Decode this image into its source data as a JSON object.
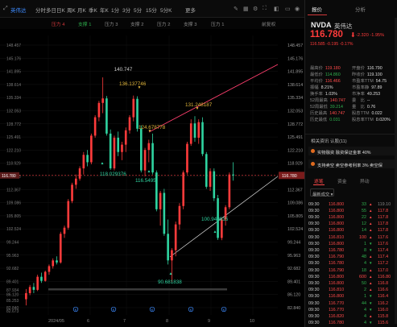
{
  "toolbar": {
    "tabs": [
      {
        "label": "分时",
        "active": false
      },
      {
        "label": "多日",
        "active": false
      },
      {
        "label": "日K",
        "active": false
      },
      {
        "label": "周K",
        "active": false
      },
      {
        "label": "月K",
        "active": false
      },
      {
        "label": "季K",
        "active": false
      },
      {
        "label": "年K",
        "active": false
      },
      {
        "label": "1分",
        "active": false
      },
      {
        "label": "3分",
        "active": false
      },
      {
        "label": "5分",
        "active": false
      },
      {
        "label": "15分",
        "active": false
      },
      {
        "label": "5分K",
        "active": false
      }
    ],
    "main_label": "英伟达",
    "more_label": "更多"
  },
  "indicators": [
    {
      "label": "压力 4",
      "color": "red"
    },
    {
      "label": "支撑 1",
      "color": "green"
    },
    {
      "label": "压力 3",
      "color": "gray"
    },
    {
      "label": "支撑 2",
      "color": "gray"
    },
    {
      "label": "压力 2",
      "color": "gray"
    },
    {
      "label": "支撑 3",
      "color": "gray"
    },
    {
      "label": "压力 1",
      "color": "gray"
    },
    {
      "label": "前复权",
      "color": "gray"
    }
  ],
  "chart_data": {
    "type": "candlestick",
    "ylim": [
      82.673,
      151.0
    ],
    "y_ticks": [
      "148.457",
      "145.176",
      "141.895",
      "138.614",
      "135.334",
      "132.053",
      "128.772",
      "125.491",
      "122.210",
      "118.929",
      "115.648",
      "112.367",
      "109.086",
      "105.805",
      "102.524",
      "99.244",
      "95.963",
      "92.682",
      "89.401",
      "86.120",
      "82.840"
    ],
    "y_ticks_bottom_labels": [
      "87.934",
      "85.253",
      "82.673"
    ],
    "current_price_label": "116.780",
    "current_price": 116.78,
    "x_ticks": [
      "2024/05",
      "6",
      "7",
      "8",
      "9",
      "10"
    ],
    "annotations": [
      {
        "text": "140.747",
        "value": 140.747,
        "kind": "high",
        "color": "#cccccc"
      },
      {
        "text": "136.137746",
        "value": 136.138,
        "kind": "pivot",
        "color": "#e0b53a"
      },
      {
        "text": "124.678778",
        "value": 124.679,
        "kind": "pivot",
        "color": "#e0b53a"
      },
      {
        "text": "131.248187",
        "value": 131.248,
        "kind": "pivot",
        "color": "#e0b53a"
      },
      {
        "text": "118.029376",
        "value": 118.029,
        "kind": "support",
        "color": "#2fd3a0"
      },
      {
        "text": "116.5495",
        "value": 116.55,
        "kind": "support",
        "color": "#2fd3a0"
      },
      {
        "text": "100.940915",
        "value": 100.941,
        "kind": "support",
        "color": "#2fd3a0"
      },
      {
        "text": "90.681838",
        "value": 90.682,
        "kind": "support",
        "color": "#2fd3a0"
      }
    ],
    "candles": [
      {
        "o": 86.5,
        "h": 89.0,
        "l": 85.0,
        "c": 88.0
      },
      {
        "o": 88.0,
        "h": 90.0,
        "l": 87.5,
        "c": 89.5
      },
      {
        "o": 89.5,
        "h": 90.5,
        "l": 88.0,
        "c": 88.8
      },
      {
        "o": 88.8,
        "h": 92.5,
        "l": 88.5,
        "c": 92.0
      },
      {
        "o": 92.0,
        "h": 93.0,
        "l": 90.5,
        "c": 91.0
      },
      {
        "o": 91.0,
        "h": 93.5,
        "l": 90.8,
        "c": 93.2
      },
      {
        "o": 93.2,
        "h": 95.0,
        "l": 92.5,
        "c": 94.6
      },
      {
        "o": 94.6,
        "h": 96.5,
        "l": 94.0,
        "c": 96.0
      },
      {
        "o": 96.0,
        "h": 97.0,
        "l": 95.0,
        "c": 95.5
      },
      {
        "o": 95.5,
        "h": 103.0,
        "l": 95.2,
        "c": 102.5
      },
      {
        "o": 102.5,
        "h": 104.5,
        "l": 101.5,
        "c": 104.0
      },
      {
        "o": 104.0,
        "h": 111.0,
        "l": 103.5,
        "c": 110.5
      },
      {
        "o": 110.5,
        "h": 115.0,
        "l": 110.0,
        "c": 114.5
      },
      {
        "o": 114.5,
        "h": 117.0,
        "l": 113.5,
        "c": 116.0
      },
      {
        "o": 116.0,
        "h": 119.0,
        "l": 115.5,
        "c": 118.5
      },
      {
        "o": 118.5,
        "h": 122.5,
        "l": 117.0,
        "c": 121.8
      },
      {
        "o": 121.8,
        "h": 123.0,
        "l": 119.0,
        "c": 120.0
      },
      {
        "o": 120.0,
        "h": 127.0,
        "l": 119.5,
        "c": 126.5
      },
      {
        "o": 126.5,
        "h": 131.5,
        "l": 126.0,
        "c": 131.0
      },
      {
        "o": 131.0,
        "h": 135.0,
        "l": 130.0,
        "c": 134.5
      },
      {
        "o": 134.5,
        "h": 140.747,
        "l": 132.0,
        "c": 135.6
      },
      {
        "o": 135.6,
        "h": 136.2,
        "l": 126.5,
        "c": 127.0
      },
      {
        "o": 127.0,
        "h": 128.0,
        "l": 118.1,
        "c": 118.5
      },
      {
        "o": 118.5,
        "h": 126.5,
        "l": 118.03,
        "c": 126.0
      },
      {
        "o": 126.0,
        "h": 127.5,
        "l": 121.5,
        "c": 122.5
      },
      {
        "o": 122.5,
        "h": 125.0,
        "l": 120.5,
        "c": 124.3
      },
      {
        "o": 124.3,
        "h": 128.5,
        "l": 122.5,
        "c": 127.8
      },
      {
        "o": 127.8,
        "h": 131.5,
        "l": 127.0,
        "c": 131.0
      },
      {
        "o": 131.0,
        "h": 136.3,
        "l": 130.0,
        "c": 135.5
      },
      {
        "o": 135.5,
        "h": 136.14,
        "l": 127.5,
        "c": 128.2
      },
      {
        "o": 128.2,
        "h": 129.0,
        "l": 117.5,
        "c": 118.0
      },
      {
        "o": 118.0,
        "h": 123.5,
        "l": 116.55,
        "c": 123.0
      },
      {
        "o": 123.0,
        "h": 125.5,
        "l": 120.0,
        "c": 124.679
      },
      {
        "o": 124.679,
        "h": 127.0,
        "l": 117.0,
        "c": 117.5
      },
      {
        "o": 117.5,
        "h": 118.0,
        "l": 108.0,
        "c": 108.5
      },
      {
        "o": 108.5,
        "h": 113.0,
        "l": 104.5,
        "c": 112.5
      },
      {
        "o": 112.5,
        "h": 113.5,
        "l": 102.0,
        "c": 102.5
      },
      {
        "o": 102.5,
        "h": 106.0,
        "l": 95.0,
        "c": 96.0
      },
      {
        "o": 96.0,
        "h": 99.0,
        "l": 90.682,
        "c": 98.5
      },
      {
        "o": 98.5,
        "h": 105.5,
        "l": 97.0,
        "c": 104.8
      },
      {
        "o": 104.8,
        "h": 110.0,
        "l": 103.5,
        "c": 109.3
      },
      {
        "o": 109.3,
        "h": 118.0,
        "l": 108.5,
        "c": 117.5
      },
      {
        "o": 117.5,
        "h": 125.0,
        "l": 117.0,
        "c": 124.5
      },
      {
        "o": 124.5,
        "h": 130.5,
        "l": 124.0,
        "c": 129.5
      },
      {
        "o": 129.5,
        "h": 131.248,
        "l": 125.0,
        "c": 126.0
      },
      {
        "o": 126.0,
        "h": 130.5,
        "l": 124.5,
        "c": 129.8
      },
      {
        "o": 129.8,
        "h": 131.0,
        "l": 121.5,
        "c": 122.0
      },
      {
        "o": 122.0,
        "h": 122.5,
        "l": 113.5,
        "c": 114.0
      },
      {
        "o": 114.0,
        "h": 118.5,
        "l": 113.0,
        "c": 117.8
      },
      {
        "o": 117.8,
        "h": 118.5,
        "l": 110.5,
        "c": 111.2
      },
      {
        "o": 111.2,
        "h": 112.0,
        "l": 101.0,
        "c": 101.5
      },
      {
        "o": 101.5,
        "h": 106.5,
        "l": 100.941,
        "c": 106.0
      },
      {
        "o": 106.0,
        "h": 109.5,
        "l": 104.5,
        "c": 109.0
      },
      {
        "o": 109.0,
        "h": 117.5,
        "l": 108.5,
        "c": 117.0
      },
      {
        "o": 117.0,
        "h": 120.0,
        "l": 115.5,
        "c": 116.78
      }
    ]
  },
  "right_panel": {
    "tabs": [
      "报价",
      "分析"
    ],
    "ticker": "NVDA",
    "name": "英伟达",
    "price": "116.780",
    "change": "-2.320  -1.95%",
    "after_hours": "116.585  -0.195  -0.17%",
    "quote_rows": [
      [
        {
          "k": "最高价",
          "v": "119.180",
          "c": "red"
        },
        {
          "k": "开盘价",
          "v": "116.790",
          "c": "white"
        }
      ],
      [
        {
          "k": "最低价",
          "v": "114.860",
          "c": "green"
        },
        {
          "k": "昨收价",
          "v": "119.100",
          "c": "white"
        }
      ],
      [
        {
          "k": "平均价",
          "v": "116.466",
          "c": "red"
        },
        {
          "k": "市盈率TTM",
          "v": "54.75",
          "c": "white"
        }
      ],
      [
        {
          "k": "振幅",
          "v": "8.21%",
          "c": "white"
        },
        {
          "k": "市盈率静",
          "v": "97.89",
          "c": "white"
        }
      ],
      [
        {
          "k": "换手率",
          "v": "1.03%",
          "c": "white"
        },
        {
          "k": "市净率",
          "v": "49.253",
          "c": "white"
        }
      ],
      [
        {
          "k": "52周最高",
          "v": "140.747",
          "c": "red"
        },
        {
          "k": "委　比",
          "v": "--",
          "c": "white"
        }
      ],
      [
        {
          "k": "52周最低",
          "v": "39.214",
          "c": "green"
        },
        {
          "k": "量　比",
          "v": "0.76",
          "c": "white"
        }
      ],
      [
        {
          "k": "历史最高",
          "v": "140.747",
          "c": "red"
        },
        {
          "k": "股息TTM",
          "v": "0.022",
          "c": "white"
        }
      ],
      [
        {
          "k": "历史最低",
          "v": "0.031",
          "c": "green"
        },
        {
          "k": "股息率TTM",
          "v": "0.020%",
          "c": "white"
        }
      ]
    ],
    "related_title": "相关资讯  认股(11)",
    "notices": [
      "实物融资  融资保证金率 40%",
      "支持卖空  卖空参考利率 3%  卖空保"
    ],
    "subtabs": [
      "逐笔",
      "资金",
      "异动"
    ],
    "filter_label": "最新成交 ▾",
    "trades": [
      {
        "t": "09:30",
        "p": "116.800",
        "v": "33",
        "d": "▲",
        "dc": "red",
        "s": "119.10",
        "sc": "gray"
      },
      {
        "t": "09:30",
        "p": "116.800",
        "v": "55",
        "d": "▲",
        "dc": "red",
        "s": "117.8",
        "sc": "red"
      },
      {
        "t": "09:30",
        "p": "116.800",
        "v": "22",
        "d": "▲",
        "dc": "red",
        "s": "117.8",
        "sc": "red"
      },
      {
        "t": "09:30",
        "p": "116.800",
        "v": "12",
        "d": "▲",
        "dc": "red",
        "s": "117.8",
        "sc": "red"
      },
      {
        "t": "09:30",
        "p": "116.800",
        "v": "14",
        "d": "▲",
        "dc": "red",
        "s": "117.8",
        "sc": "red"
      },
      {
        "t": "09:30",
        "p": "116.810",
        "v": "100",
        "d": "▲",
        "dc": "red",
        "s": "117.6",
        "sc": "red"
      },
      {
        "t": "09:30",
        "p": "116.800",
        "v": "1",
        "d": "▼",
        "dc": "green",
        "s": "117.6",
        "sc": "red"
      },
      {
        "t": "09:30",
        "p": "116.780",
        "v": "8",
        "d": "▼",
        "dc": "green",
        "s": "117.4",
        "sc": "red"
      },
      {
        "t": "09:30",
        "p": "116.790",
        "v": "48",
        "d": "▲",
        "dc": "red",
        "s": "117.4",
        "sc": "red"
      },
      {
        "t": "09:30",
        "p": "116.780",
        "v": "4",
        "d": "▼",
        "dc": "green",
        "s": "117.2",
        "sc": "red"
      },
      {
        "t": "09:30",
        "p": "116.790",
        "v": "18",
        "d": "▲",
        "dc": "red",
        "s": "117.0",
        "sc": "red"
      },
      {
        "t": "09:30",
        "p": "116.800",
        "v": "600",
        "d": "▲",
        "dc": "red",
        "s": "116.80",
        "sc": "red"
      },
      {
        "t": "09:30",
        "p": "116.800",
        "v": "50",
        "d": "▲",
        "dc": "red",
        "s": "116.8",
        "sc": "red"
      },
      {
        "t": "09:30",
        "p": "116.810",
        "v": "2",
        "d": "▲",
        "dc": "red",
        "s": "116.6",
        "sc": "red"
      },
      {
        "t": "09:30",
        "p": "116.800",
        "v": "1",
        "d": "▼",
        "dc": "green",
        "s": "116.4",
        "sc": "red"
      },
      {
        "t": "09:30",
        "p": "116.770",
        "v": "44",
        "d": "▼",
        "dc": "green",
        "s": "116.2",
        "sc": "red"
      },
      {
        "t": "09:30",
        "p": "116.770",
        "v": "4",
        "d": "▼",
        "dc": "green",
        "s": "116.0",
        "sc": "red"
      },
      {
        "t": "09:30",
        "p": "116.820",
        "v": "4",
        "d": "▲",
        "dc": "red",
        "s": "115.8",
        "sc": "red"
      },
      {
        "t": "09:30",
        "p": "116.780",
        "v": "4",
        "d": "▼",
        "dc": "green",
        "s": "115.6",
        "sc": "red"
      }
    ]
  },
  "colors": {
    "up": "#ff3b3b",
    "down": "#2fd3a0",
    "support_line": "#e0e0e0",
    "resistance_line": "#ff3f6e",
    "price_line": "#d1383a",
    "pivot": "#e0b53a",
    "accent": "#3d8bff"
  }
}
